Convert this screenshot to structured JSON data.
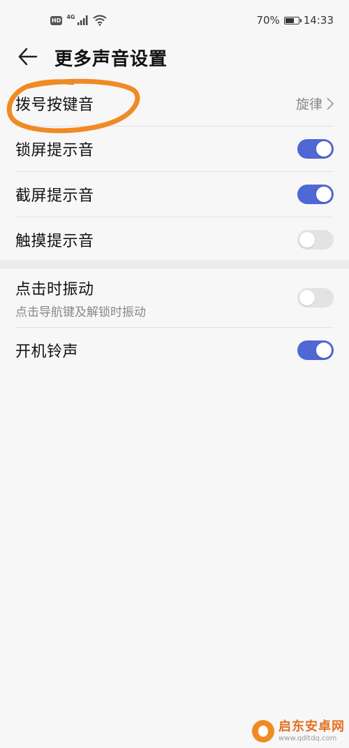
{
  "status_bar": {
    "hd_badge": "HD",
    "network": "4G",
    "battery_percent": "70%",
    "battery_level": 0.7,
    "time": "14:33"
  },
  "header": {
    "title": "更多声音设置",
    "back_icon": "arrow-left-icon"
  },
  "group1": {
    "rows": [
      {
        "label": "拨号按键音",
        "value": "旋律",
        "type": "link"
      },
      {
        "label": "锁屏提示音",
        "type": "toggle",
        "on": true
      },
      {
        "label": "截屏提示音",
        "type": "toggle",
        "on": true
      },
      {
        "label": "触摸提示音",
        "type": "toggle",
        "on": false
      }
    ]
  },
  "group2": {
    "rows": [
      {
        "label": "点击时振动",
        "sublabel": "点击导航键及解锁时振动",
        "type": "toggle",
        "on": false
      },
      {
        "label": "开机铃声",
        "type": "toggle",
        "on": true
      }
    ]
  },
  "watermark": {
    "title": "启东安卓网",
    "url": "www.qdltdq.com"
  },
  "colors": {
    "accent": "#5067d6",
    "annotation": "#f08a24",
    "toggle_off": "#e3e3e3",
    "background": "#f7f7f7"
  }
}
